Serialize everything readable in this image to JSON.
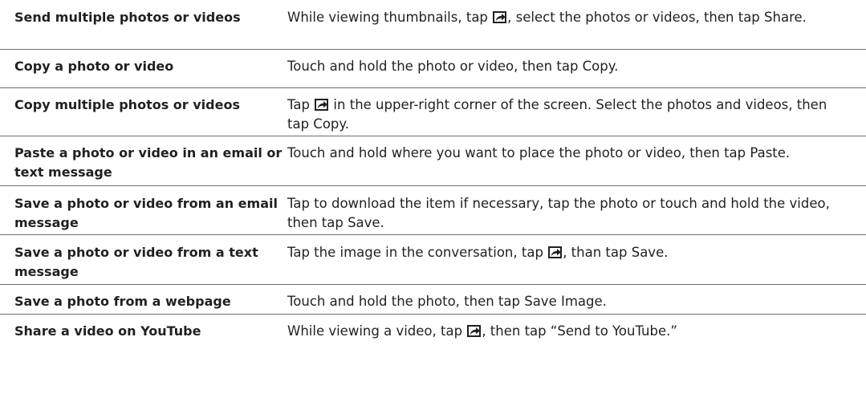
{
  "rows": [
    {
      "task": "Send multiple photos or videos",
      "how": {
        "before": "While viewing thumbnails, tap ",
        "icon": "share-icon",
        "after": ", select the photos or videos, then tap Share."
      }
    },
    {
      "task": "Copy a photo or video",
      "how": {
        "before": "Touch and hold the photo or video, then tap Copy.",
        "icon": "",
        "after": ""
      }
    },
    {
      "task": "Copy multiple photos or videos",
      "how": {
        "before": "Tap ",
        "icon": "share-icon",
        "after": " in the upper-right corner of the screen. Select the photos and videos, then tap Copy."
      }
    },
    {
      "task": "Paste a photo or video in an email or text message",
      "how": {
        "before": "Touch and hold where you want to place the photo or video, then tap Paste.",
        "icon": "",
        "after": ""
      }
    },
    {
      "task": "Save a photo or video from an email message",
      "how": {
        "before": "Tap to download the item if necessary, tap the photo or touch and hold the video, then tap Save.",
        "icon": "",
        "after": ""
      }
    },
    {
      "task": "Save a photo or video from a text message",
      "how": {
        "before": "Tap the image in the conversation, tap ",
        "icon": "share-icon",
        "after": ", than tap Save."
      }
    },
    {
      "task": "Save a photo from a webpage",
      "how": {
        "before": "Touch and hold the photo, then tap Save Image.",
        "icon": "",
        "after": ""
      }
    },
    {
      "task": "Share a video on YouTube",
      "how": {
        "before": "While viewing a video, tap ",
        "icon": "share-icon",
        "after": ", then tap “Send to YouTube.”"
      }
    }
  ],
  "colors": {
    "text": "#231f20",
    "rule": "#6d6e71",
    "icon": "#231f20"
  }
}
